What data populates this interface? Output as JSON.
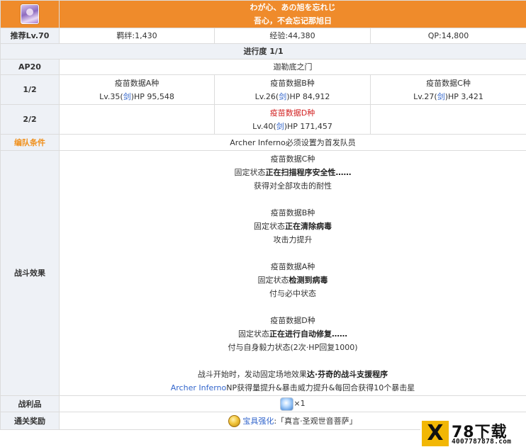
{
  "header": {
    "title_jp": "わが心、あの旭を忘れじ",
    "title_cn": "吾心，不会忘记那旭日"
  },
  "stats": {
    "level_label": "推荐Lv.70",
    "bond": "羁绊:1,430",
    "exp": "经验:44,380",
    "qp": "QP:14,800"
  },
  "progress": "进行度 1/1",
  "ap": {
    "label": "AP20",
    "location": "迦勒底之门"
  },
  "waves": [
    {
      "label": "1/2",
      "enemies": [
        {
          "name": "疫苗数据A种",
          "lv": "Lv.35(",
          "cls": "剑",
          "hp": ")HP 95,548"
        },
        {
          "name": "疫苗数据B种",
          "lv": "Lv.26(",
          "cls": "剑",
          "hp": ")HP 84,912"
        },
        {
          "name": "疫苗数据C种",
          "lv": "Lv.27(",
          "cls": "剑",
          "hp": ")HP 3,421"
        }
      ]
    },
    {
      "label": "2/2",
      "enemies": [
        {
          "name": "疫苗数据D种",
          "lv": "Lv.40(",
          "cls": "剑",
          "hp": ")HP 171,457"
        }
      ]
    }
  ],
  "formation": {
    "label": "编队条件",
    "text": "Archer Inferno必须设置为首发队员"
  },
  "battle": {
    "label": "战斗效果",
    "blocks": [
      {
        "name": "疫苗数据C种",
        "state_prefix": "固定状态",
        "state": "正在扫描程序安全性……",
        "effect": "获得对全部攻击的耐性"
      },
      {
        "name": "疫苗数据B种",
        "state_prefix": "固定状态",
        "state": "正在清除病毒",
        "effect": "攻击力提升"
      },
      {
        "name": "疫苗数据A种",
        "state_prefix": "固定状态",
        "state": "检测到病毒",
        "effect": "付与必中状态"
      },
      {
        "name": "疫苗数据D种",
        "state_prefix": "固定状态",
        "state": "正在进行自动修复……",
        "effect": "付与自身毅力状态(2次·HP回复1000)"
      }
    ],
    "field_prefix": "战斗开始时，发动固定场地效果",
    "field_name": "达·芬奇的战斗支援程序",
    "buff_servant": "Archer Inferno",
    "buff_text": "NP获得量提升&暴击威力提升&每回合获得10个暴击星"
  },
  "drops": {
    "label": "战利品",
    "count": "×1",
    "icon": "crystal-icon"
  },
  "reward": {
    "label": "通关奖励",
    "link": "宝具强化",
    "text": ":「真言·圣观世音菩萨」",
    "icon": "medal-icon"
  },
  "watermark": {
    "mark": "X",
    "brand": "78下载",
    "url": "4007787878.com"
  },
  "colors": {
    "header_orange": "#ef8b2b",
    "label_bg": "#eef1f6",
    "link_blue": "#3366cc",
    "red": "#d22222"
  }
}
